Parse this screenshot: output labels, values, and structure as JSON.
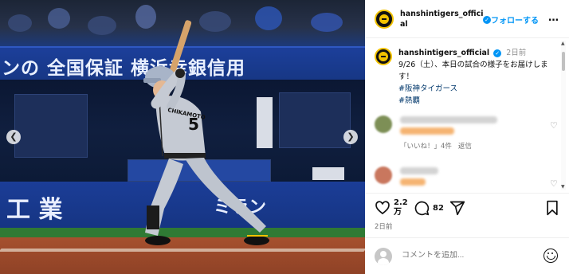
{
  "post": {
    "photo_alt": "Batter in grey Hanshin Tigers uniform number 5 swinging",
    "banner_top_text": "ンの  全国保証   横浜幸銀信用",
    "banner_low_text": "工 業",
    "banner_low_text2": "ミラン",
    "jersey_name": "CHIKAMOTO",
    "jersey_number": "5"
  },
  "header": {
    "username_line1": "hanshintigers_offici",
    "username_line2": "al",
    "dot": "•",
    "follow_label": "フォローする",
    "more_label": "…"
  },
  "caption": {
    "username": "hanshintigers_official",
    "time": "2日前",
    "text": "9/26（土）、本日の試合の様子をお届けします！",
    "hashtags": [
      "#阪神タイガース",
      "#熱覇"
    ]
  },
  "comments": [
    {
      "meta_likes": "「いいね！」4件",
      "meta_reply": "返信"
    }
  ],
  "actions": {
    "like_count_line1": "2.2",
    "like_count_line2": "万",
    "comment_count": "82",
    "timestamp": "2日前"
  },
  "add_comment": {
    "placeholder": "コメントを追加..."
  },
  "colors": {
    "accent": "#0095f6",
    "hashtag": "#00376b",
    "tigers_yellow": "#f2c200"
  },
  "icons": [
    "chevron-left-icon",
    "chevron-right-icon",
    "verified-icon",
    "more-icon",
    "heart-icon",
    "comment-icon",
    "share-icon",
    "bookmark-icon",
    "emoji-icon"
  ]
}
